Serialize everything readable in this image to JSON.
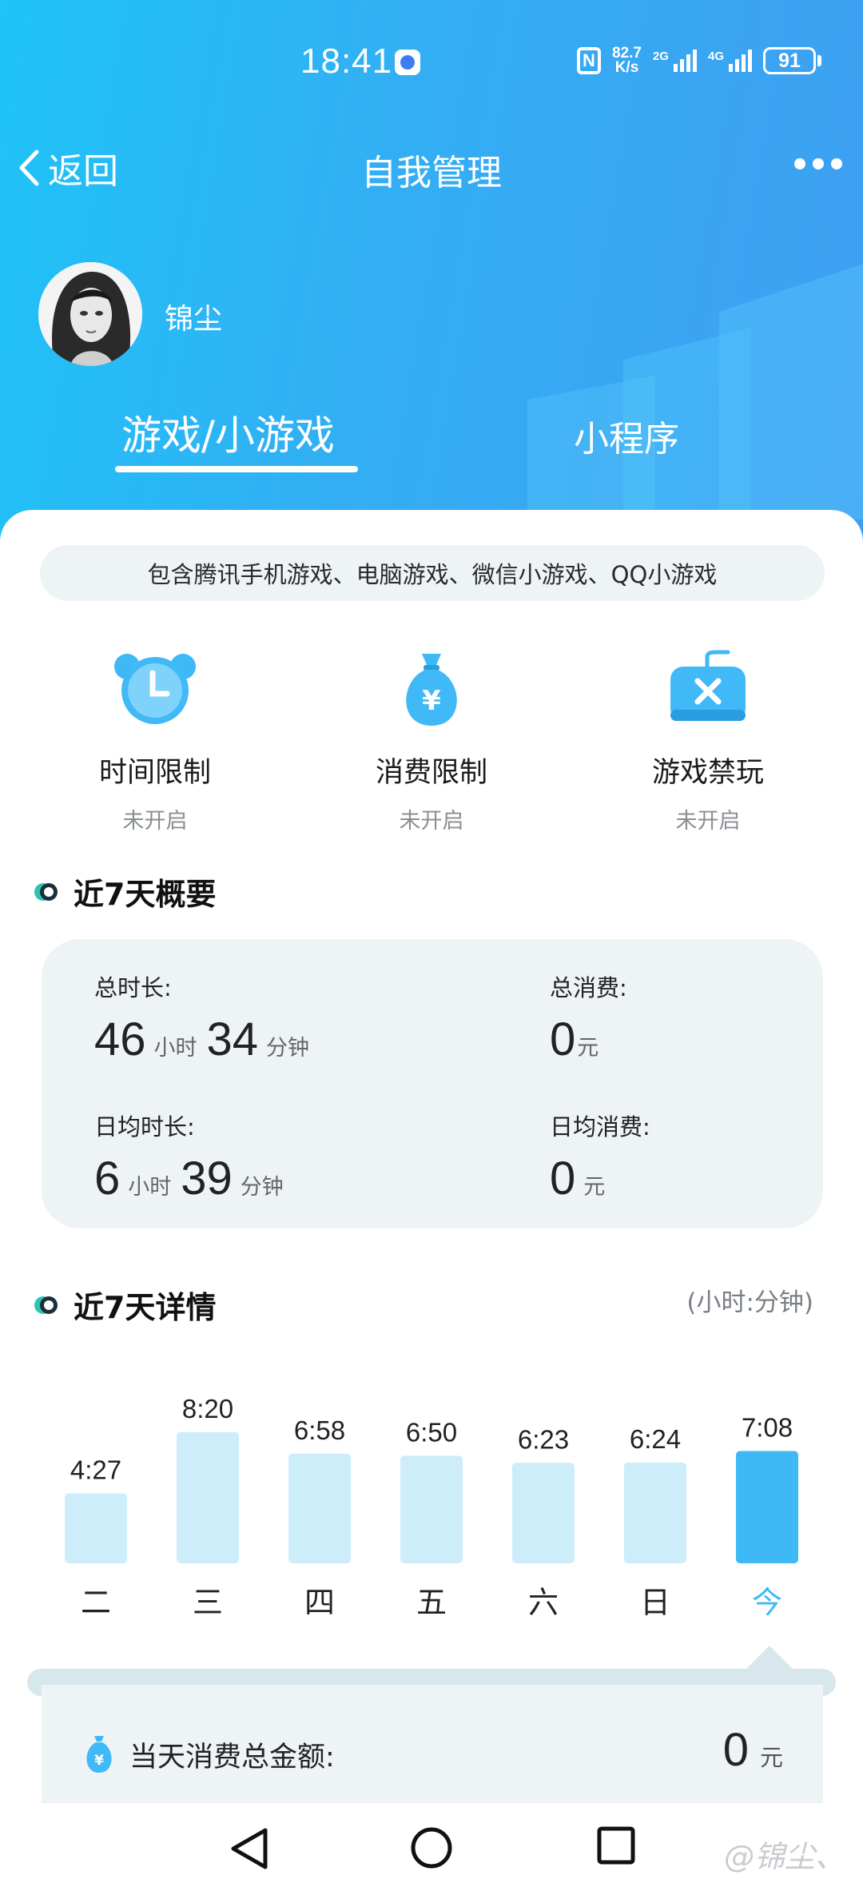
{
  "status_bar": {
    "time": "18:41",
    "nfc": "N",
    "speed_value": "82.7",
    "speed_unit": "K/s",
    "net1": "2G",
    "net2": "4G",
    "battery": "91"
  },
  "nav": {
    "back_label": "返回",
    "title": "自我管理",
    "more_icon": "more-dots-icon"
  },
  "profile": {
    "username": "锦尘"
  },
  "tabs": [
    {
      "label": "游戏/小游戏",
      "active": true
    },
    {
      "label": "小程序",
      "active": false
    }
  ],
  "notice": "包含腾讯手机游戏、电脑游戏、微信小游戏、QQ小游戏",
  "features": [
    {
      "label": "时间限制",
      "status": "未开启",
      "icon": "alarm-clock-icon"
    },
    {
      "label": "消费限制",
      "status": "未开启",
      "icon": "money-bag-icon"
    },
    {
      "label": "游戏禁玩",
      "status": "未开启",
      "icon": "gamepad-block-icon"
    }
  ],
  "summary": {
    "title": "近7天概要",
    "total_time_label": "总时长:",
    "total_time_hours": "46",
    "total_time_minutes": "34",
    "hour_unit": "小时",
    "minute_unit": "分钟",
    "total_spend_label": "总消费:",
    "total_spend": "0",
    "yuan": "元",
    "avg_time_label": "日均时长:",
    "avg_time_hours": "6",
    "avg_time_minutes": "39",
    "avg_spend_label": "日均消费:",
    "avg_spend": "0"
  },
  "details": {
    "title": "近7天详情",
    "unit_note": "(小时:分钟)"
  },
  "chart_data": {
    "type": "bar",
    "categories": [
      "二",
      "三",
      "四",
      "五",
      "六",
      "日",
      "今"
    ],
    "values": [
      4.45,
      8.333,
      6.967,
      6.833,
      6.383,
      6.4,
      7.133
    ],
    "labels": [
      "4:27",
      "8:20",
      "6:58",
      "6:50",
      "6:23",
      "6:24",
      "7:08"
    ],
    "highlight_index": 6,
    "colors": {
      "normal": "#cdedfb",
      "highlight": "#3fb8f6",
      "label": "#222222",
      "highlight_label": "#3fb8f6"
    }
  },
  "today_spend": {
    "label": "当天消费总金额:",
    "value": "0",
    "unit": "元"
  },
  "watermark": "@锦尘、",
  "colors": {
    "accent": "#3fb8f6",
    "brand_gradient_start": "#1ec3f7",
    "brand_gradient_end": "#3f9ef2"
  }
}
